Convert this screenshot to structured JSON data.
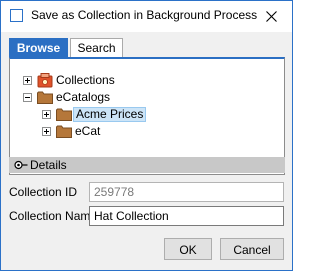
{
  "window": {
    "title": "Save as Collection in Background Process"
  },
  "tabs": [
    {
      "label": "Browse",
      "active": true
    },
    {
      "label": "Search",
      "active": false
    }
  ],
  "tree": {
    "collections": {
      "label": "Collections"
    },
    "ecatalogs": {
      "label": "eCatalogs"
    },
    "acme_prices": {
      "label": "Acme Prices",
      "selected": true
    },
    "ecat": {
      "label": "eCat"
    }
  },
  "details": {
    "label": "Details"
  },
  "form": {
    "collection_id_label": "Collection ID",
    "collection_id_value": "259778",
    "collection_name_label": "Collection Name",
    "collection_name_value": "Hat Collection"
  },
  "buttons": {
    "ok": "OK",
    "cancel": "Cancel"
  },
  "colors": {
    "accent": "#2b6fc3",
    "selection": "#cce4f7",
    "folder": "#b5773a",
    "collections_icon": "#e0522a"
  }
}
